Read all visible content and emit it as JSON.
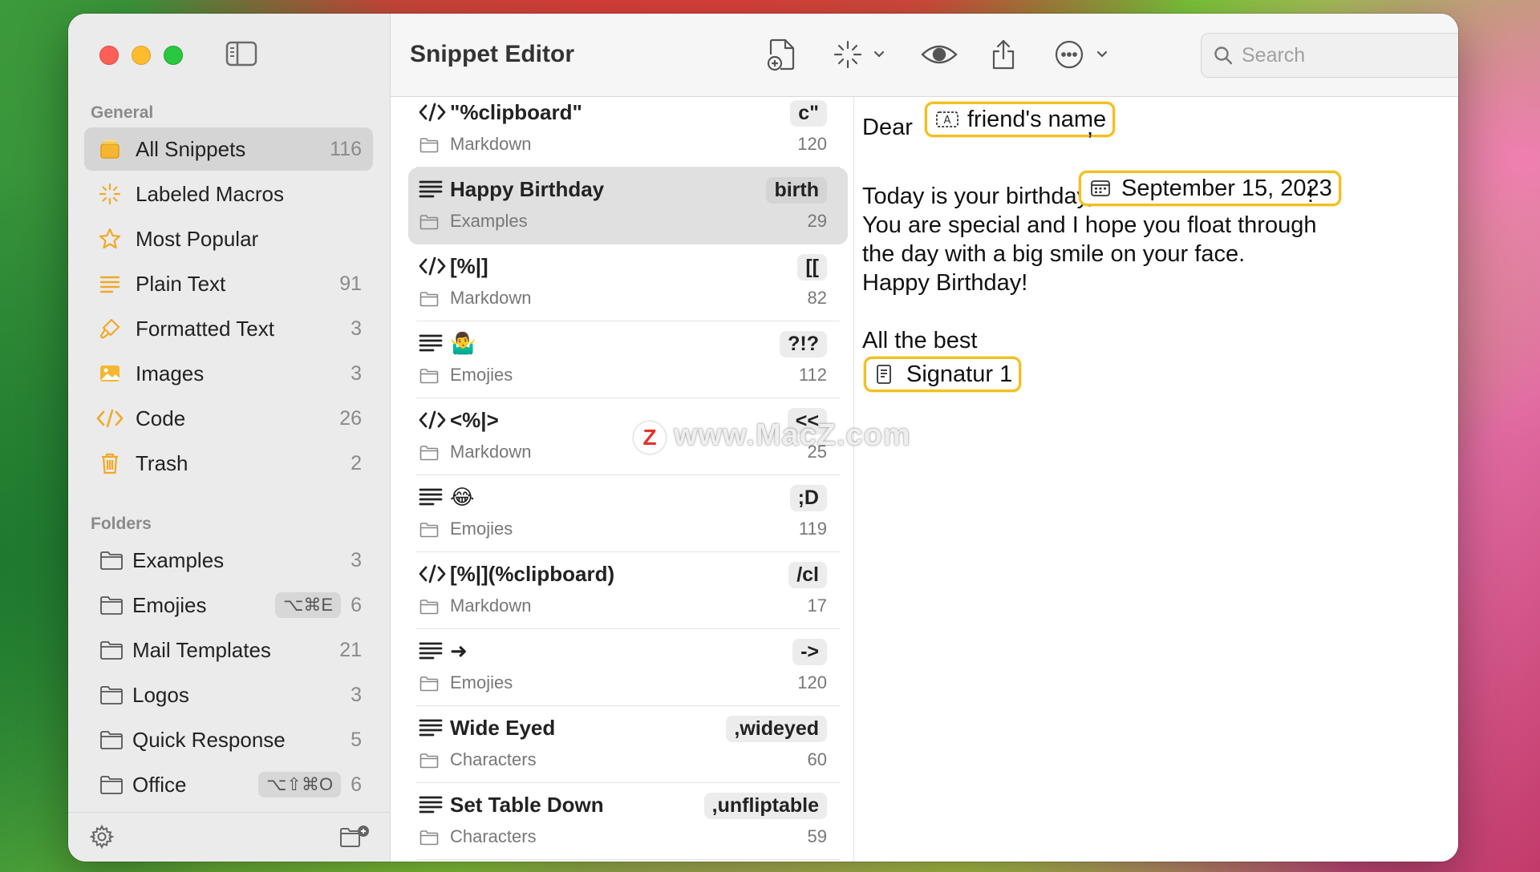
{
  "app": {
    "title": "Snippet Editor"
  },
  "search": {
    "placeholder": "Search"
  },
  "sidebar": {
    "general_header": "General",
    "folders_header": "Folders",
    "general": [
      {
        "label": "All Snippets",
        "count": "116",
        "icon": "stack-icon"
      },
      {
        "label": "Labeled Macros",
        "count": "",
        "icon": "sparkle-icon"
      },
      {
        "label": "Most Popular",
        "count": "",
        "icon": "star-icon"
      },
      {
        "label": "Plain Text",
        "count": "91",
        "icon": "lines-icon"
      },
      {
        "label": "Formatted Text",
        "count": "3",
        "icon": "brush-icon"
      },
      {
        "label": "Images",
        "count": "3",
        "icon": "image-icon"
      },
      {
        "label": "Code",
        "count": "26",
        "icon": "code-icon"
      },
      {
        "label": "Trash",
        "count": "2",
        "icon": "trash-icon"
      }
    ],
    "folders": [
      {
        "label": "Examples",
        "count": "3",
        "shortcut": ""
      },
      {
        "label": "Emojies",
        "count": "6",
        "shortcut": "⌥⌘E"
      },
      {
        "label": "Mail Templates",
        "count": "21",
        "shortcut": ""
      },
      {
        "label": "Logos",
        "count": "3",
        "shortcut": ""
      },
      {
        "label": "Quick Response",
        "count": "5",
        "shortcut": ""
      },
      {
        "label": "Office",
        "count": "6",
        "shortcut": "⌥⇧⌘O"
      }
    ]
  },
  "snippets": [
    {
      "kind": "code",
      "name": "\"%clipboard\"",
      "abbr": "c\"",
      "folder": "Markdown",
      "uses": "120"
    },
    {
      "kind": "text",
      "name": "Happy Birthday",
      "abbr": "birth",
      "folder": "Examples",
      "uses": "29"
    },
    {
      "kind": "code",
      "name": "[%|]",
      "abbr": "[[",
      "folder": "Markdown",
      "uses": "82"
    },
    {
      "kind": "text",
      "name": "🤷‍♂️",
      "abbr": "?!?",
      "folder": "Emojies",
      "uses": "112"
    },
    {
      "kind": "code",
      "name": "<%|>",
      "abbr": "<<",
      "folder": "Markdown",
      "uses": "25"
    },
    {
      "kind": "text",
      "name": "😂",
      "abbr": ";D",
      "folder": "Emojies",
      "uses": "119"
    },
    {
      "kind": "code",
      "name": "[%|](%clipboard)",
      "abbr": "/cl",
      "folder": "Markdown",
      "uses": "17"
    },
    {
      "kind": "text",
      "name": "➜",
      "abbr": "->",
      "folder": "Emojies",
      "uses": "120"
    },
    {
      "kind": "text",
      "name": "Wide Eyed",
      "abbr": ",wideyed",
      "folder": "Characters",
      "uses": "60"
    },
    {
      "kind": "text",
      "name": "Set Table Down",
      "abbr": ",unfliptable",
      "folder": "Characters",
      "uses": "59"
    }
  ],
  "editor": {
    "dear": "Dear",
    "comma": ",",
    "name_token": "friend's name",
    "line1": "Today is your birthday,",
    "date_token": "September 15, 2023",
    "excl": "!",
    "line2": "You are special and I hope you float through",
    "line3": "the day with a big smile on your face.",
    "line4": "Happy Birthday!",
    "closing": "All the best",
    "signature_token": "Signatur 1"
  },
  "watermark": {
    "text": "www.MacZ.com",
    "badge": "Z"
  }
}
